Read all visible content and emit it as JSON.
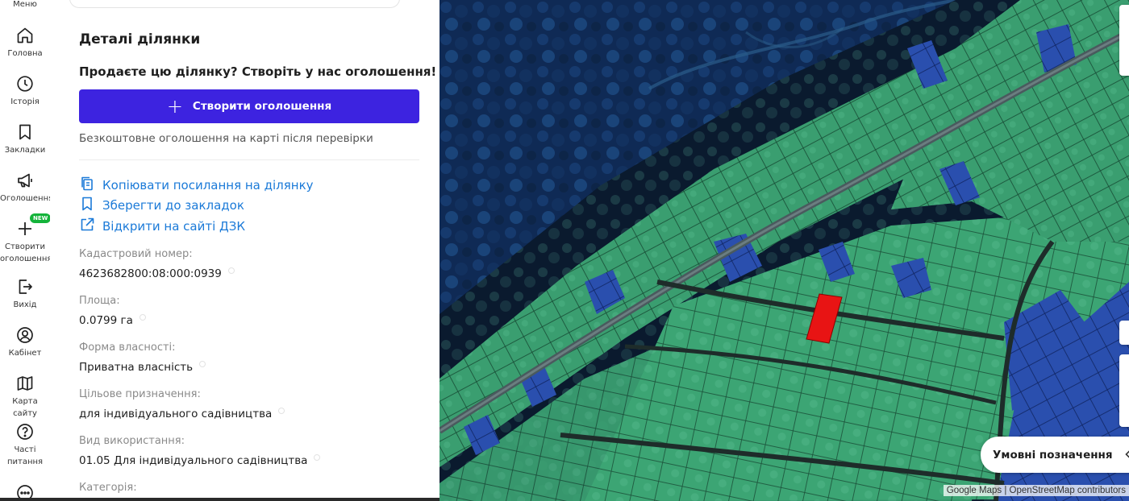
{
  "rail": {
    "menu_label": "Меню",
    "items": [
      {
        "label": "Головна",
        "icon": "home-icon"
      },
      {
        "label": "Історія",
        "icon": "clock-icon"
      },
      {
        "label": "Закладки",
        "icon": "bookmark-icon"
      },
      {
        "label": "Оголошення",
        "icon": "megaphone-icon"
      },
      {
        "label": "Створити оголошення",
        "icon": "plus-icon",
        "badge": "NEW"
      },
      {
        "label": "Вихід",
        "icon": "logout-icon"
      },
      {
        "label": "Кабінет",
        "icon": "user-icon"
      },
      {
        "label": "Карта сайту",
        "icon": "map-icon"
      },
      {
        "label": "Часті питання",
        "icon": "question-icon"
      }
    ]
  },
  "panel": {
    "title": "Деталі ділянки",
    "promo": "Продаєте цю ділянку? Створіть у нас оголошення!",
    "create_button": "Створити оголошення",
    "free_note": "Безкоштовне оголошення на карті після перевірки",
    "links": {
      "copy": "Копіювати посилання на ділянку",
      "bookmark": "Зберегти до закладок",
      "open_dzk": "Відкрити на сайті ДЗК"
    },
    "fields": [
      {
        "label": "Кадастровий номер:",
        "value": "4623682800:08:000:0939"
      },
      {
        "label": "Площа:",
        "value": "0.0799 га"
      },
      {
        "label": "Форма власності:",
        "value": "Приватна власність"
      },
      {
        "label": "Цільове призначення:",
        "value": "для індивідуального садівництва"
      },
      {
        "label": "Вид використання:",
        "value": "01.05 Для індивідуального садівництва"
      },
      {
        "label": "Категорія:",
        "value": ""
      }
    ]
  },
  "map": {
    "legend_button": "Умовні позначення",
    "attribution": "Google Maps | OpenStreetMap contributors",
    "colors": {
      "parcel_green": "#3fa875",
      "parcel_blue": "#2f56b8",
      "selected": "#e81414",
      "accent": "#3d23e0",
      "link": "#1b7ad8"
    }
  }
}
